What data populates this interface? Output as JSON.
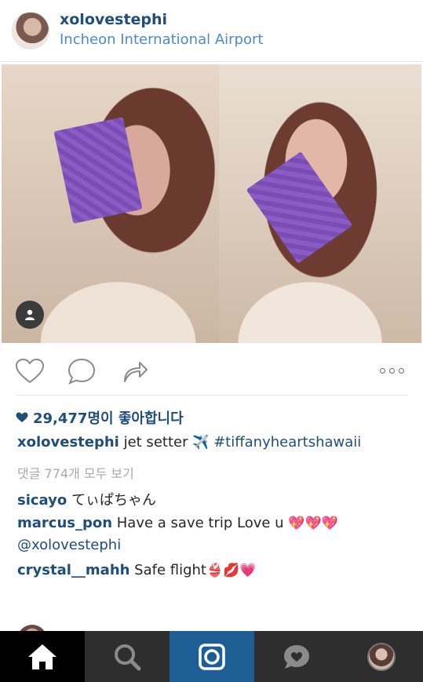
{
  "post": {
    "username": "xolovestephi",
    "location": "Incheon International Airport",
    "likes": "29,477명이 좋아합니다",
    "caption": {
      "username": "xolovestephi",
      "text": " jet setter ",
      "emoji": "✈️",
      "hashtag": " #tiffanyheartshawaii"
    },
    "view_comments": "댓글 774개 모두 보기",
    "comments": [
      {
        "username": "sicayo",
        "text": " てぃぱちゃん"
      },
      {
        "username": "marcus_pon",
        "text": " Have a save trip Love u ",
        "emoji": "💖💖💖",
        "text2": "@xolovestephi"
      },
      {
        "username": "crystal__mahh",
        "text": " Safe flight",
        "emoji": "👙💋💗"
      }
    ]
  },
  "icons": {
    "like": "heart-icon",
    "comment": "comment-icon",
    "share": "share-icon",
    "more": "more-icon",
    "tag": "person-icon"
  },
  "tabbar": {
    "items": [
      "home-icon",
      "search-icon",
      "camera-icon",
      "activity-icon",
      "profile-icon"
    ],
    "active_color": "#1d5f94"
  },
  "colors": {
    "username": "#1f4e79",
    "location": "#4a8bc7",
    "muted": "#a8a8a8"
  }
}
